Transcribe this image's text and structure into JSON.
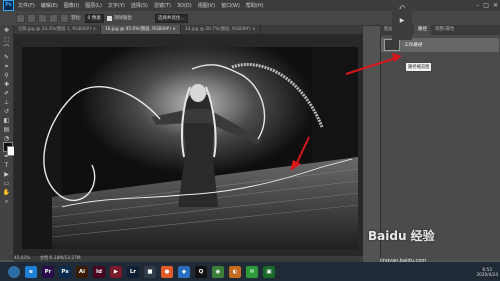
{
  "app": {
    "logo": "Ps"
  },
  "menu": [
    "文件(F)",
    "编辑(E)",
    "图像(I)",
    "图层(L)",
    "文字(Y)",
    "选择(S)",
    "滤镜(T)",
    "3D(D)",
    "视图(V)",
    "窗口(W)",
    "帮助(H)"
  ],
  "window_controls": [
    "–",
    "□",
    "✕"
  ],
  "options": {
    "feather_label": "羽化:",
    "feather_value": "0 像素",
    "antialias_label": "消除锯齿",
    "select_mask_label": "选择并遮住..."
  },
  "tabs": [
    {
      "label": "豆邪.jpg @ 33.3%(图层 1, RGB/8#) ×",
      "active": false
    },
    {
      "label": "16.jpg @ 45.6%(图层, RGB/8#) ×",
      "active": true
    },
    {
      "label": "14.jpg @ 20.7%(图层, RGB/8#) ×",
      "active": false
    }
  ],
  "status": {
    "zoom": "45.61%",
    "doc": "文档:6.18M/13.27M"
  },
  "panel": {
    "tabs": [
      {
        "label": "图层",
        "active": false
      },
      {
        "label": "通道",
        "active": false
      },
      {
        "label": "路径",
        "active": true
      },
      {
        "label": "调整/属性",
        "active": false
      }
    ],
    "path_name": "工作路径",
    "tooltip": "路径缩览图"
  },
  "taskbar": {
    "apps": [
      {
        "name": "start",
        "label": "",
        "color": "#2d6da3"
      },
      {
        "name": "edge",
        "label": "e",
        "color": "#1e7fd6"
      },
      {
        "name": "premiere",
        "label": "Pr",
        "color": "#2a0b48"
      },
      {
        "name": "photoshop",
        "label": "Ps",
        "color": "#0b2c4f"
      },
      {
        "name": "illustrator",
        "label": "Ai",
        "color": "#3a1b00"
      },
      {
        "name": "indesign",
        "label": "Id",
        "color": "#49021f"
      },
      {
        "name": "media-player",
        "label": "▶",
        "color": "#7a1a2a"
      },
      {
        "name": "lightroom",
        "label": "Lr",
        "color": "#0b1f35"
      },
      {
        "name": "video",
        "label": "■",
        "color": "#2f3b48"
      },
      {
        "name": "app-colorful",
        "label": "●",
        "color": "#e05a2a"
      },
      {
        "name": "app-blue",
        "label": "◆",
        "color": "#2a6fbf"
      },
      {
        "name": "qq",
        "label": "Q",
        "color": "#111111"
      },
      {
        "name": "chrome",
        "label": "◉",
        "color": "#3a7e3a"
      },
      {
        "name": "app-orange",
        "label": "◐",
        "color": "#c66a1f"
      },
      {
        "name": "wechat",
        "label": "✉",
        "color": "#2d9a3a"
      },
      {
        "name": "app-green",
        "label": "▣",
        "color": "#1a6a2a"
      }
    ],
    "clock_time": "6:53",
    "clock_date": "2020/4/24"
  },
  "watermark": {
    "text": "Baidu 经验",
    "url": "jingyan.baidu.com"
  },
  "colors": {
    "annotation_arrow": "#d8171a",
    "path_stroke": "#e8e8e8"
  }
}
